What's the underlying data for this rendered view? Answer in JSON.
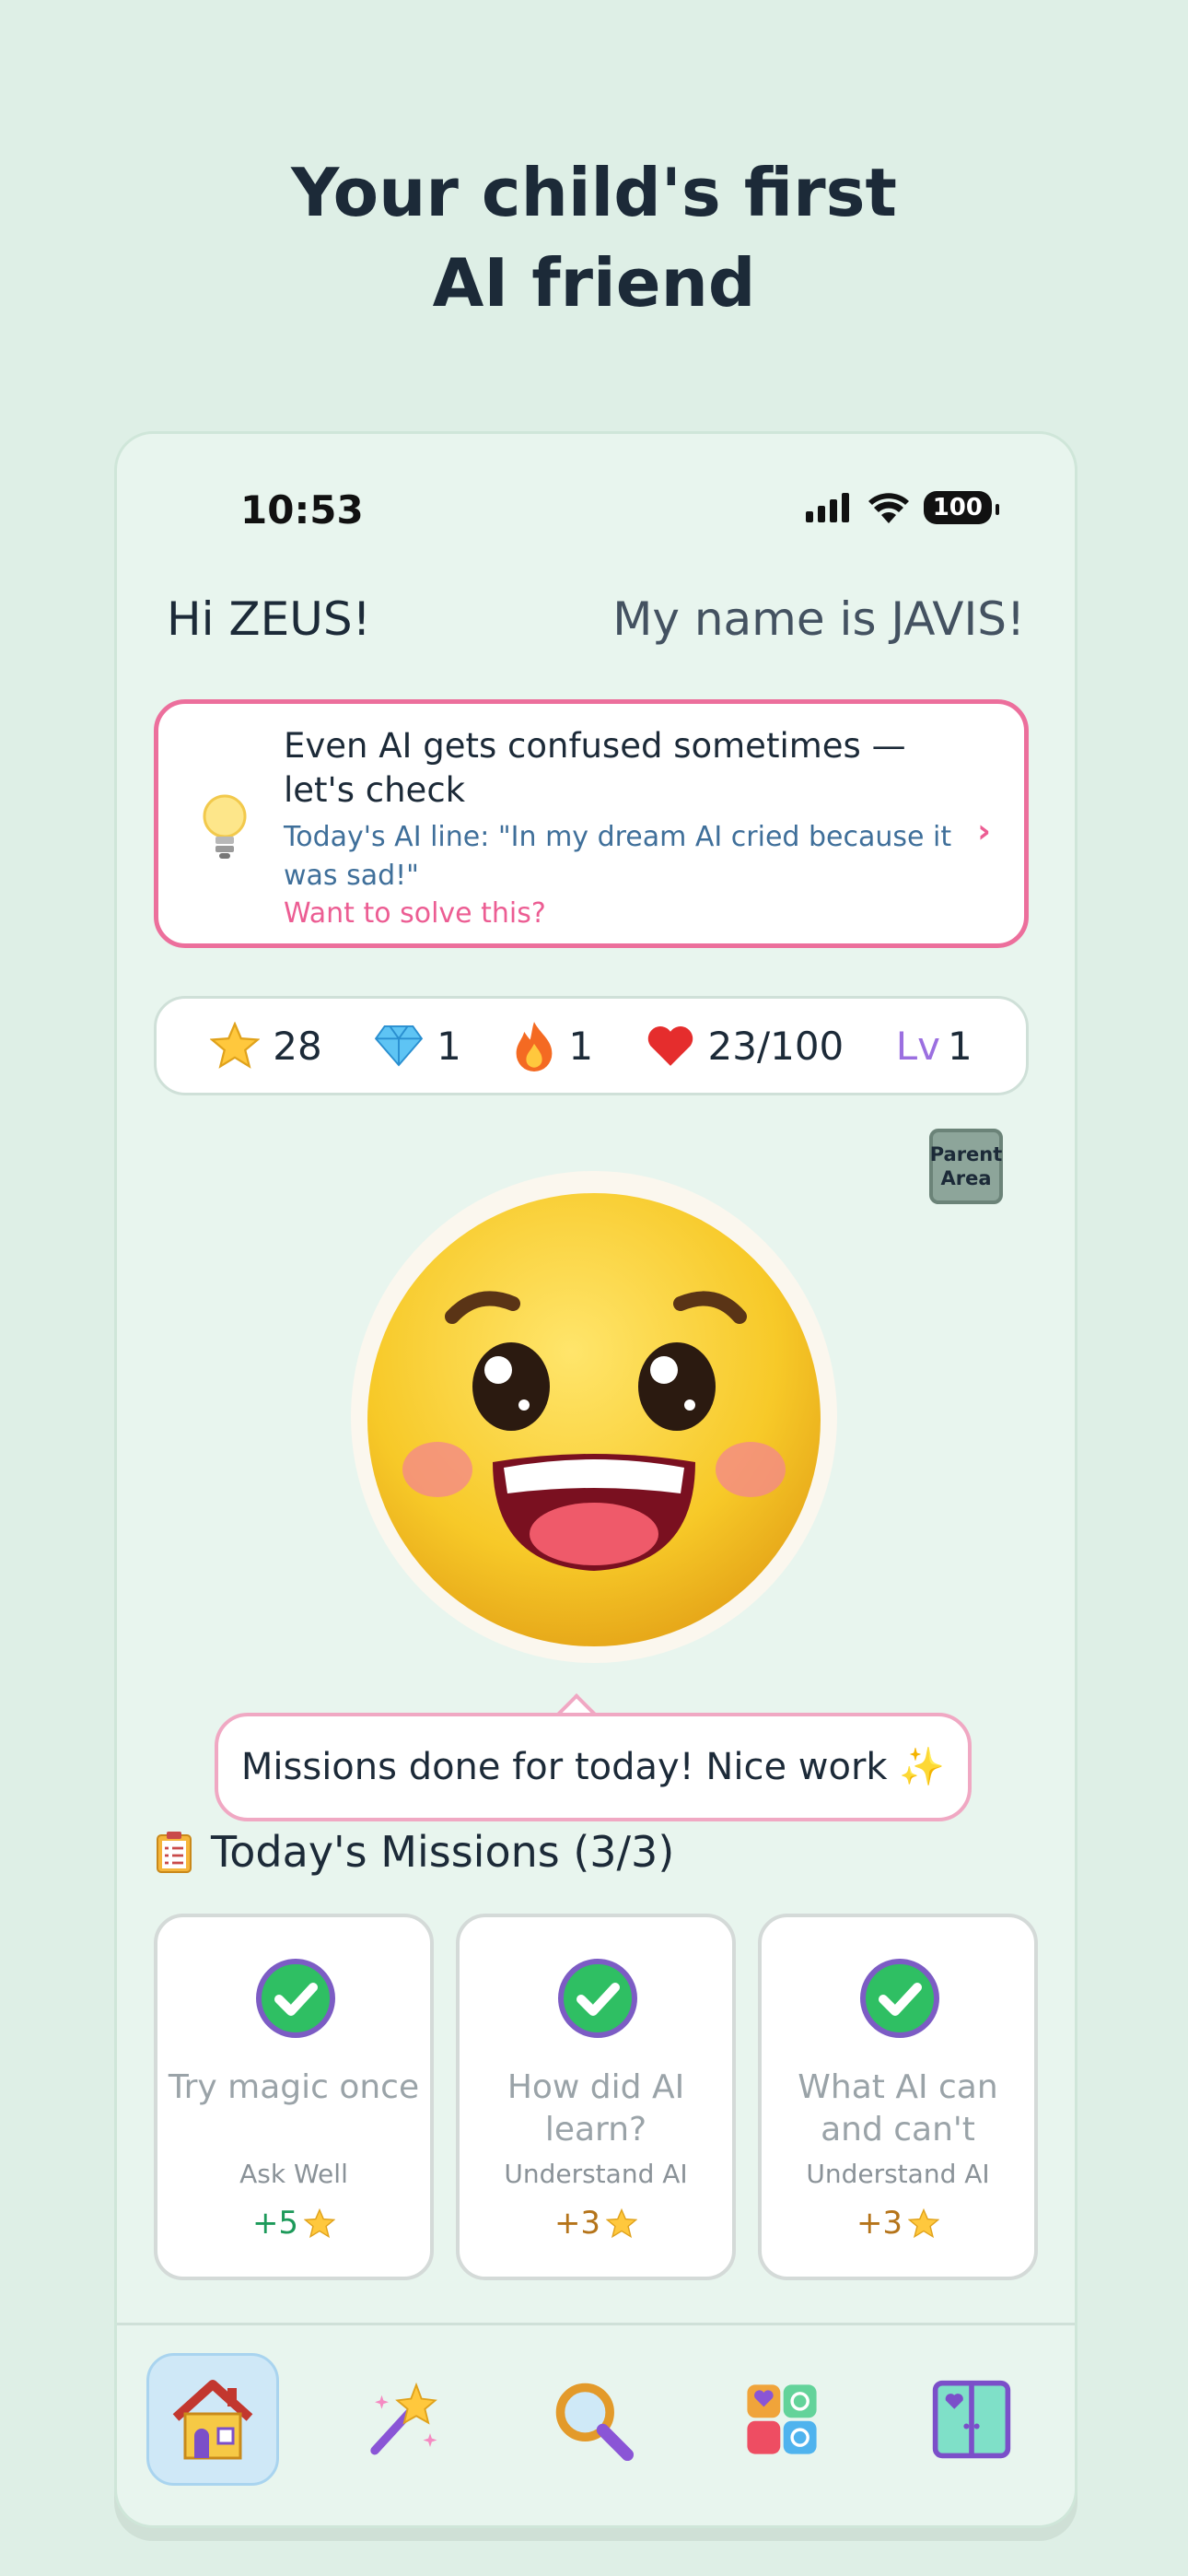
{
  "headline": {
    "line1": "Your child's first",
    "line2": "AI friend"
  },
  "status_bar": {
    "time": "10:53",
    "battery": "100"
  },
  "greeting": {
    "hello": "Hi ZEUS!",
    "intro": "My name is JAVIS!"
  },
  "tip_card": {
    "title": "Even AI gets confused sometimes — let's check",
    "ai_line": "Today's AI line: \"In my dream AI cried because it was sad!\"",
    "cta": "Want to solve this?",
    "arrow": "›"
  },
  "stats": {
    "stars": "28",
    "gems": "1",
    "streak": "1",
    "hearts": "23/100",
    "level_label": "Lv",
    "level": "1"
  },
  "parent_area": {
    "label": "Parent Area"
  },
  "speech_bubble": "Missions done for today! Nice work ✨",
  "missions": {
    "heading": "Today's Missions (3/3)",
    "items": [
      {
        "title": "Try magic once",
        "category": "Ask Well",
        "points": "+5",
        "points_color": "#1d9a5a",
        "done": true
      },
      {
        "title": "How did AI learn?",
        "category": "Understand AI",
        "points": "+3",
        "points_color": "#b5741a",
        "done": true
      },
      {
        "title": "What AI can and can't",
        "category": "Understand AI",
        "points": "+3",
        "points_color": "#b5741a",
        "done": true
      }
    ]
  },
  "tabs": [
    {
      "icon": "home-icon",
      "active": true
    },
    {
      "icon": "magic-wand-icon",
      "active": false
    },
    {
      "icon": "magnifier-icon",
      "active": false
    },
    {
      "icon": "apps-grid-icon",
      "active": false
    },
    {
      "icon": "door-icon",
      "active": false
    }
  ],
  "colors": {
    "background": "#deefe6",
    "accent_pink": "#ec6f9c",
    "check_green": "#2fbf63"
  }
}
